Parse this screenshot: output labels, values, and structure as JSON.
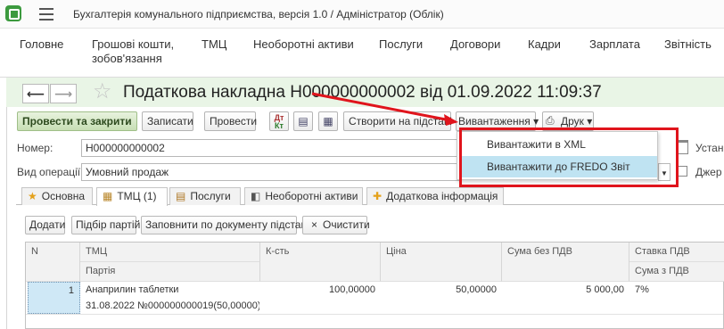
{
  "titlebar": {
    "title": "Бухгалтерія комунального підприємства, версія 1.0 / Адміністратор  (Облік)"
  },
  "menu": {
    "items": [
      "Головне",
      "Грошові кошти,\nзобов'язання",
      "ТМЦ",
      "Необоротні активи",
      "Послуги",
      "Договори",
      "Кадри",
      "Зарплата",
      "Звітність"
    ]
  },
  "document": {
    "title": "Податкова накладна Н000000000002 від 01.09.2022 11:09:37"
  },
  "toolbar": {
    "post_close": "Провести та закрити",
    "save": "Записати",
    "post": "Провести",
    "dt_kt_top": "Дт",
    "dt_kt_bottom": "Кт",
    "create_based": "Створити на підставі",
    "upload": "Вивантаження ▾",
    "print": "Друк ▾"
  },
  "dropdown": {
    "items": [
      "Вивантажити в XML",
      "Вивантажити до FREDO Звіт"
    ]
  },
  "form": {
    "number_label": "Номер:",
    "number_value": "Н000000000002",
    "operation_label": "Вид операції:",
    "operation_value": "Умовний продаж",
    "right_label_1": "Устан",
    "right_label_2": "Джер"
  },
  "tabs": [
    "Основна",
    "ТМЦ (1)",
    "Послуги",
    "Необоротні активи",
    "Додаткова інформація"
  ],
  "grid_toolbar": {
    "add": "Додати",
    "select_batches": "Підбір партій",
    "fill_by_basis": "Заповнити по документу підстави",
    "clear": "Очистити"
  },
  "grid": {
    "headers": [
      "N",
      "ТМЦ",
      "Партія",
      "К-сть",
      "Ціна",
      "Сума без ПДВ",
      "Ставка ПДВ",
      "Сума з ПДВ"
    ],
    "rows": [
      {
        "n": "1",
        "item": "Анаприлин таблетки",
        "batch": "31.08.2022 №000000000019(50,00000)",
        "qty": "100,00000",
        "price": "50,00000",
        "sum_no_vat": "5 000,00",
        "vat_rate": "7%"
      }
    ]
  },
  "colors": {
    "header_green": "#e9f5e6",
    "highlight": "#bfe3f2",
    "annotation_red": "#e0141c"
  }
}
